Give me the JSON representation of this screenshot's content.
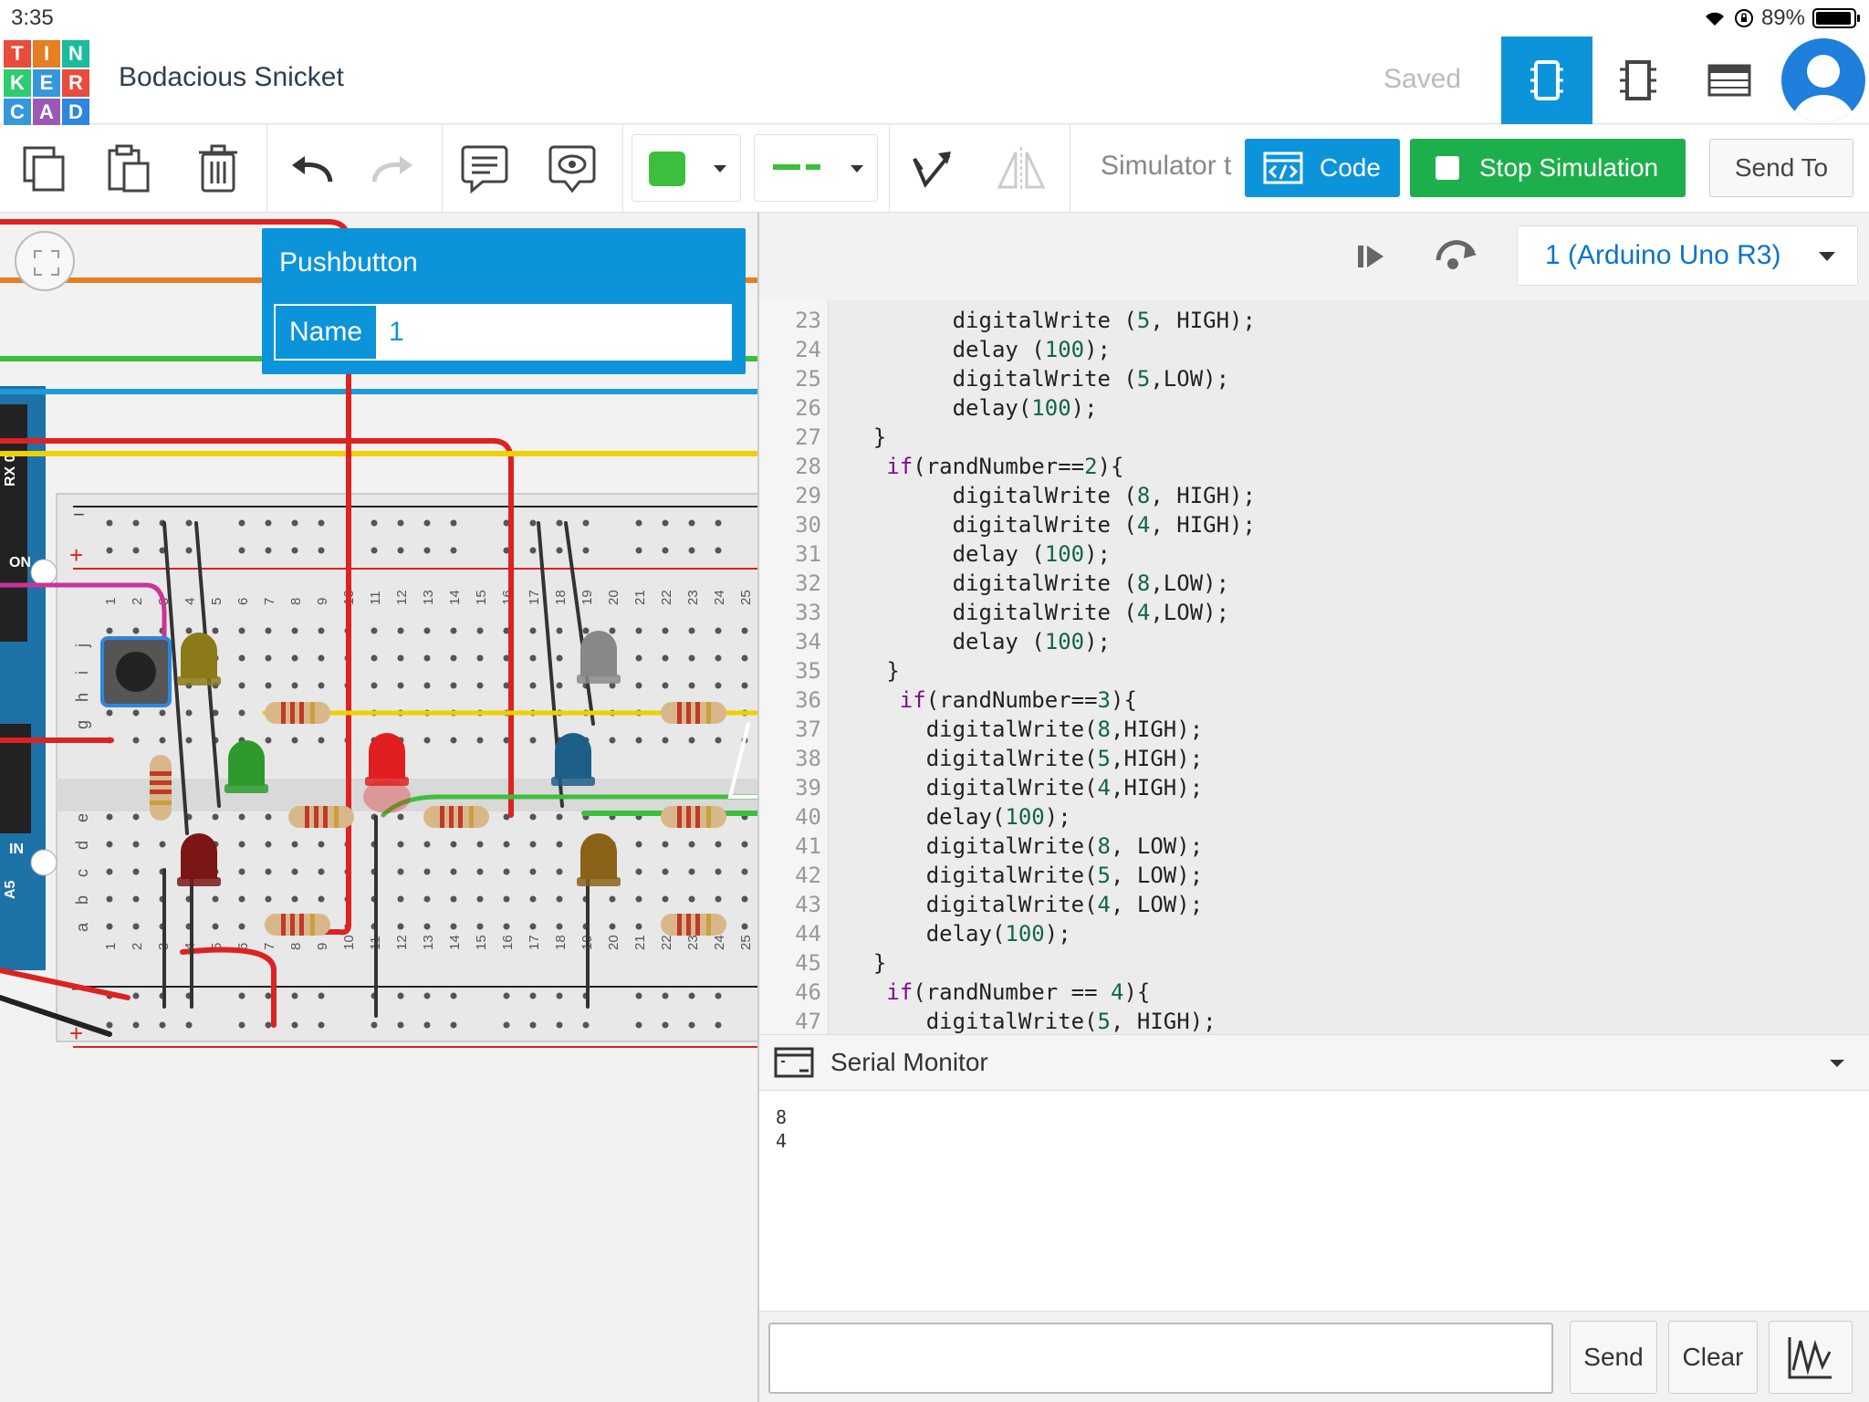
{
  "status_bar": {
    "time": "3:35",
    "battery": "89%"
  },
  "header": {
    "logo_letters": [
      "T",
      "I",
      "N",
      "K",
      "E",
      "R",
      "C",
      "A",
      "D"
    ],
    "logo_colors": [
      "#e74c3c",
      "#e67e22",
      "#1abc9c",
      "#2ecc71",
      "#3498db",
      "#e74c3c",
      "#3498db",
      "#9b59b6",
      "#2e86de"
    ],
    "project_title": "Bodacious Snicket",
    "save_status": "Saved",
    "view_buttons": [
      "circuit-view-icon",
      "component-view-icon",
      "list-view-icon"
    ]
  },
  "toolbar": {
    "icons": [
      "copy-icon",
      "paste-icon",
      "delete-icon",
      "undo-icon",
      "redo-icon",
      "note-icon",
      "view-notes-icon",
      "color-swatch",
      "wire-style",
      "rotate-icon",
      "flip-icon"
    ],
    "color_value": "#3cbf3c",
    "simulator_label": "Simulator t",
    "code_label": "Code",
    "stop_label": "Stop Simulation",
    "send_to_label": "Send To"
  },
  "popup": {
    "title": "Pushbutton",
    "name_label": "Name",
    "name_value": "1"
  },
  "code_panel": {
    "device": "1 (Arduino Uno R3)",
    "lines": [
      {
        "n": "23",
        "t": "        digitalWrite (5, HIGH);"
      },
      {
        "n": "24",
        "t": "        delay (100);"
      },
      {
        "n": "25",
        "t": "        digitalWrite (5,LOW);"
      },
      {
        "n": "26",
        "t": "        delay(100);"
      },
      {
        "n": "27",
        "t": "  }"
      },
      {
        "n": "28",
        "t": "   if(randNumber==2){"
      },
      {
        "n": "29",
        "t": "        digitalWrite (8, HIGH);"
      },
      {
        "n": "30",
        "t": "        digitalWrite (4, HIGH);"
      },
      {
        "n": "31",
        "t": "        delay (100);"
      },
      {
        "n": "32",
        "t": "        digitalWrite (8,LOW);"
      },
      {
        "n": "33",
        "t": "        digitalWrite (4,LOW);"
      },
      {
        "n": "34",
        "t": "        delay (100);"
      },
      {
        "n": "35",
        "t": "   }"
      },
      {
        "n": "36",
        "t": "    if(randNumber==3){"
      },
      {
        "n": "37",
        "t": "      digitalWrite(8,HIGH);"
      },
      {
        "n": "38",
        "t": "      digitalWrite(5,HIGH);"
      },
      {
        "n": "39",
        "t": "      digitalWrite(4,HIGH);"
      },
      {
        "n": "40",
        "t": "      delay(100);"
      },
      {
        "n": "41",
        "t": "      digitalWrite(8, LOW);"
      },
      {
        "n": "42",
        "t": "      digitalWrite(5, LOW);"
      },
      {
        "n": "43",
        "t": "      digitalWrite(4, LOW);"
      },
      {
        "n": "44",
        "t": "      delay(100);"
      },
      {
        "n": "45",
        "t": "  }"
      },
      {
        "n": "46",
        "t": "   if(randNumber == 4){"
      },
      {
        "n": "47",
        "t": "      digitalWrite(5, HIGH);"
      }
    ]
  },
  "serial_monitor": {
    "title": "Serial Monitor",
    "output": [
      "8",
      "4"
    ],
    "send_label": "Send",
    "clear_label": "Clear"
  },
  "breadboard": {
    "column_numbers": [
      "1",
      "2",
      "3",
      "4",
      "5",
      "6",
      "7",
      "8",
      "9",
      "10",
      "11",
      "12",
      "13",
      "14",
      "15",
      "16",
      "17",
      "18",
      "19",
      "20",
      "21",
      "22",
      "23",
      "24",
      "25"
    ],
    "row_letters_top": [
      "j",
      "i",
      "h",
      "g"
    ],
    "row_letters_bottom": [
      "e",
      "d",
      "c",
      "b",
      "a"
    ],
    "rail_minus": "−",
    "rail_plus": "+",
    "arduino_labels": [
      "RX 0",
      "ON",
      "IN",
      "A5"
    ]
  }
}
